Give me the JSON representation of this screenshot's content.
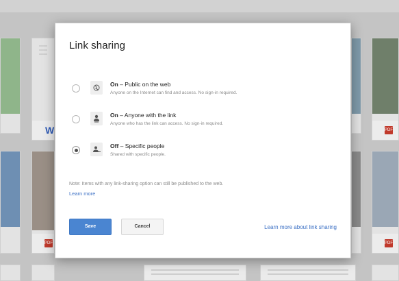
{
  "dialog": {
    "title": "Link sharing",
    "options": [
      {
        "state": "On",
        "label": " – Public on the web",
        "description": "Anyone on the Internet can find and access. No sign-in required.",
        "icon": "globe-icon",
        "selected": false
      },
      {
        "state": "On",
        "label": " – Anyone with the link",
        "description": "Anyone who has the link can access. No sign-in required.",
        "icon": "person-link-icon",
        "selected": false
      },
      {
        "state": "Off",
        "label": " – Specific people",
        "description": "Shared with specific people.",
        "icon": "people-icon",
        "selected": true
      }
    ],
    "note": "Note: Items with any link-sharing option can still be published to the web.",
    "note_link": "Learn more",
    "save_label": "Save",
    "cancel_label": "Cancel",
    "learn_more_label": "Learn more about link sharing"
  },
  "background": {
    "badge_pdf": "PDF",
    "badge_doc": "W"
  },
  "colors": {
    "accent": "#4a85d1",
    "link": "#3a6fc4",
    "pdf_badge": "#c0392b"
  }
}
